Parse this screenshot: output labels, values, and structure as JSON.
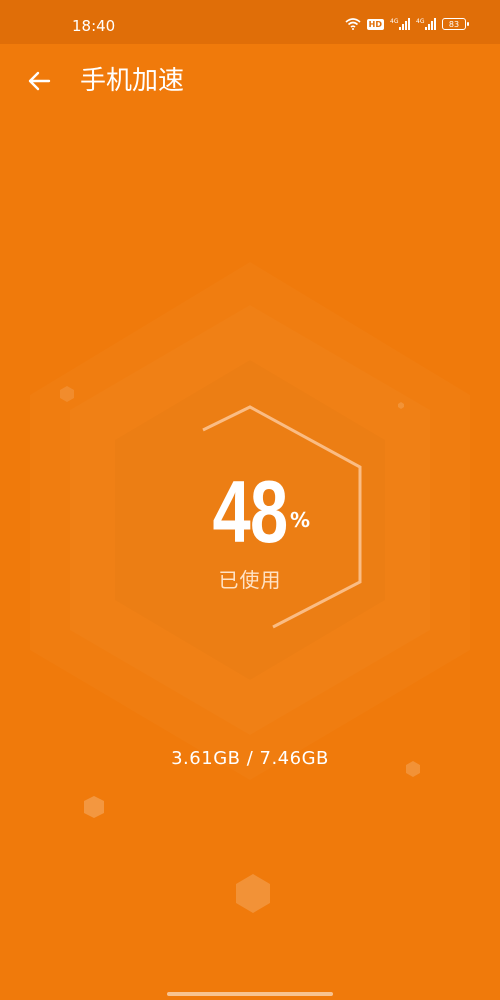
{
  "status_bar": {
    "time": "18:40",
    "hd_label": "HD",
    "battery_level": "83",
    "icons": [
      "wifi-icon",
      "hd-icon",
      "signal-4g-icon",
      "signal-4g-icon",
      "battery-icon"
    ]
  },
  "header": {
    "back_icon": "arrow-left-icon",
    "title": "手机加速"
  },
  "memory": {
    "percent": "48",
    "percent_sign": "%",
    "used_label": "已使用",
    "usage_text": "3.61GB / 7.46GB"
  },
  "colors": {
    "background": "#f07a0b",
    "status_bar": "#e06e08",
    "text": "#ffffff",
    "label": "#ffe3c6"
  }
}
